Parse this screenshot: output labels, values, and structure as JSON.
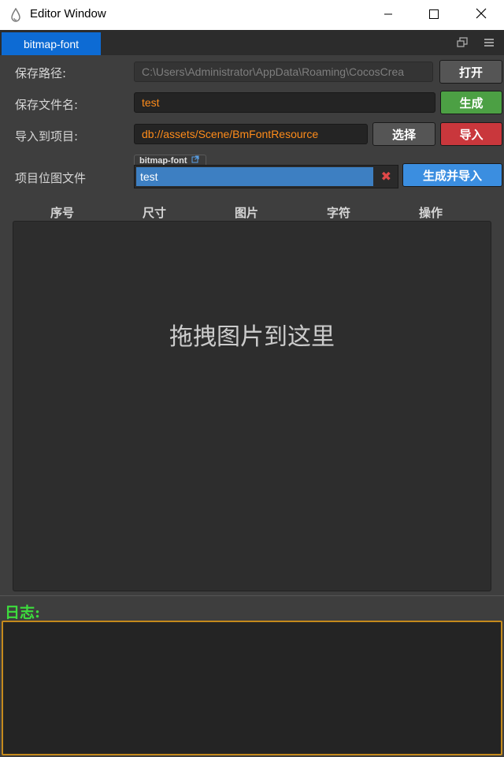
{
  "window": {
    "title": "Editor Window",
    "minimize_icon": "minimize-icon",
    "maximize_icon": "maximize-icon",
    "close_icon": "close-icon"
  },
  "tabs": [
    {
      "label": "bitmap-font"
    }
  ],
  "form": {
    "save_path": {
      "label": "保存路径:",
      "value": "C:\\Users\\Administrator\\AppData\\Roaming\\CocosCrea",
      "button": "打开"
    },
    "save_filename": {
      "label": "保存文件名:",
      "value": "test",
      "button": "生成"
    },
    "import_to_project": {
      "label": "导入到项目:",
      "value": "db://assets/Scene/BmFontResource",
      "select_button": "选择",
      "import_button": "导入"
    },
    "project_bitmap_file": {
      "label": "项目位图文件",
      "asset_type": "bitmap-font",
      "value": "test",
      "button": "生成并导入"
    }
  },
  "table": {
    "columns": [
      "序号",
      "尺寸",
      "图片",
      "字符",
      "操作"
    ],
    "drop_hint": "拖拽图片到这里"
  },
  "log": {
    "title": "日志:"
  },
  "colors": {
    "accent_blue": "#0d6bd4",
    "value_orange": "#ff8c1a",
    "success_green": "#4ca044",
    "danger_red": "#c9373c",
    "log_title_green": "#3ddc3d",
    "log_border": "#c58a1c"
  }
}
